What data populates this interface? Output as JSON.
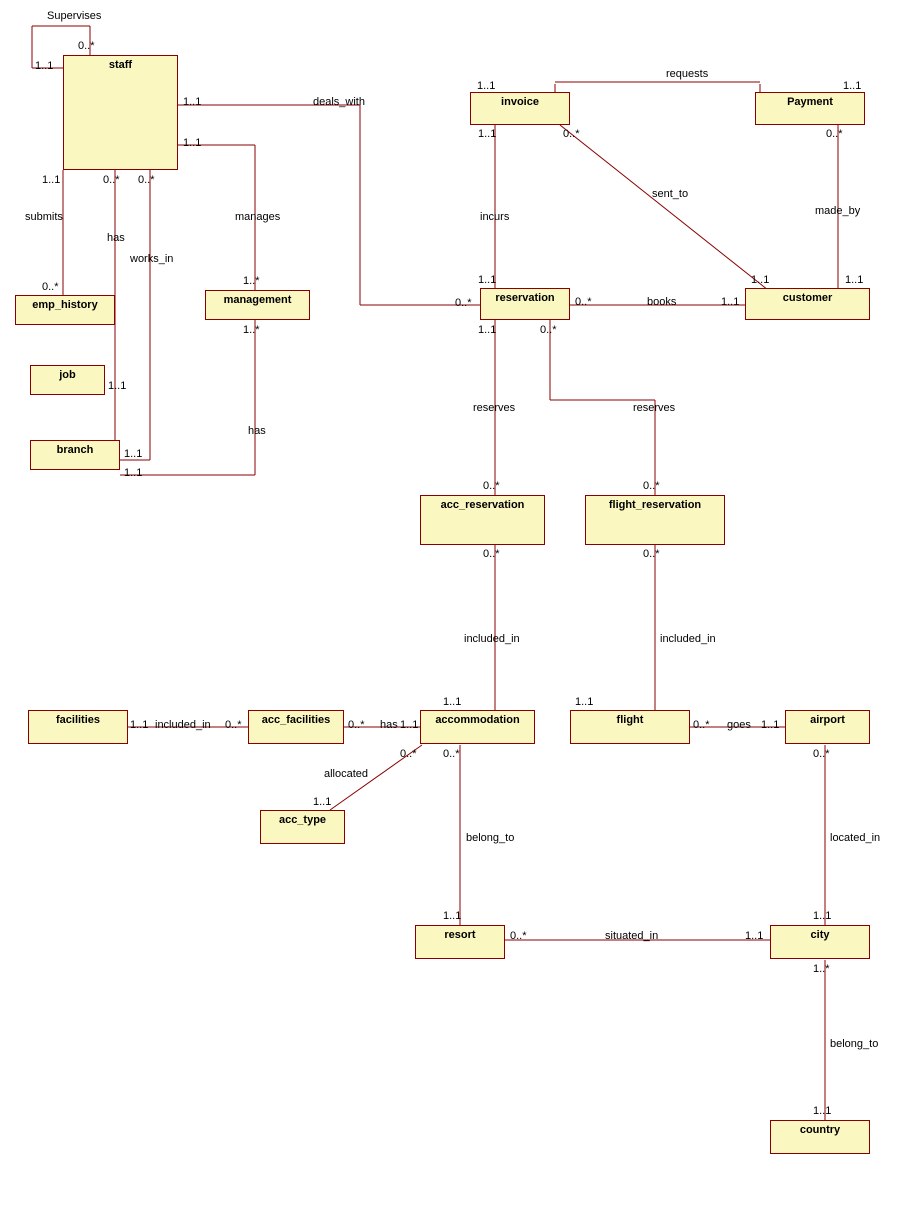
{
  "entities": {
    "staff": "staff",
    "emp_history": "emp_history",
    "job": "job",
    "branch": "branch",
    "management": "management",
    "invoice": "invoice",
    "payment": "Payment",
    "reservation": "reservation",
    "customer": "customer",
    "acc_reservation": "acc_reservation",
    "flight_reservation": "flight_reservation",
    "facilities": "facilities",
    "acc_facilities": "acc_facilities",
    "accommodation": "accommodation",
    "flight": "flight",
    "airport": "airport",
    "acc_type": "acc_type",
    "resort": "resort",
    "city": "city",
    "country": "country"
  },
  "rel": {
    "supervises": "Supervises",
    "submits": "submits",
    "has": "has",
    "works_in": "works_in",
    "manages": "manages",
    "deals_with": "deals_with",
    "requests": "requests",
    "sent_to": "sent_to",
    "made_by": "made_by",
    "incurs": "incurs",
    "books": "books",
    "reserves": "reserves",
    "included_in": "included_in",
    "allocated": "allocated",
    "belong_to": "belong_to",
    "situated_in": "situated_in",
    "located_in": "located_in",
    "goes": "goes"
  },
  "card": {
    "zero_star": "0..*",
    "one_one": "1..1",
    "one_star": "1..*"
  }
}
